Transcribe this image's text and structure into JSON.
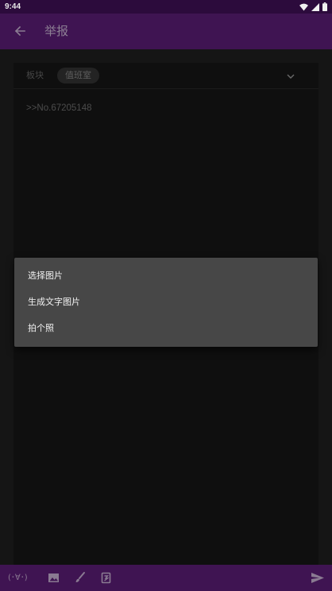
{
  "status_bar": {
    "time": "9:44",
    "icons": [
      "wifi-icon",
      "signal-icon",
      "battery-icon"
    ]
  },
  "app_bar": {
    "back_icon": "arrow-left-icon",
    "title": "举报"
  },
  "form": {
    "section_label": "板块",
    "section_value": "值班室",
    "section_dropdown_icon": "chevron-down-icon",
    "content_text": ">>No.67205148"
  },
  "popup_menu": {
    "items": [
      {
        "label": "选择图片"
      },
      {
        "label": "生成文字图片"
      },
      {
        "label": "拍个照"
      }
    ]
  },
  "toolbar": {
    "kaomoji_label": "(･∀･)",
    "icons": [
      "image-icon",
      "brush-icon",
      "dice-icon",
      "send-icon"
    ]
  },
  "colors": {
    "status_bar_bg": "#2c0b3c",
    "app_bar_bg": "#3f1452",
    "menu_bg": "#474747",
    "menu_text": "#f2f2f2"
  }
}
